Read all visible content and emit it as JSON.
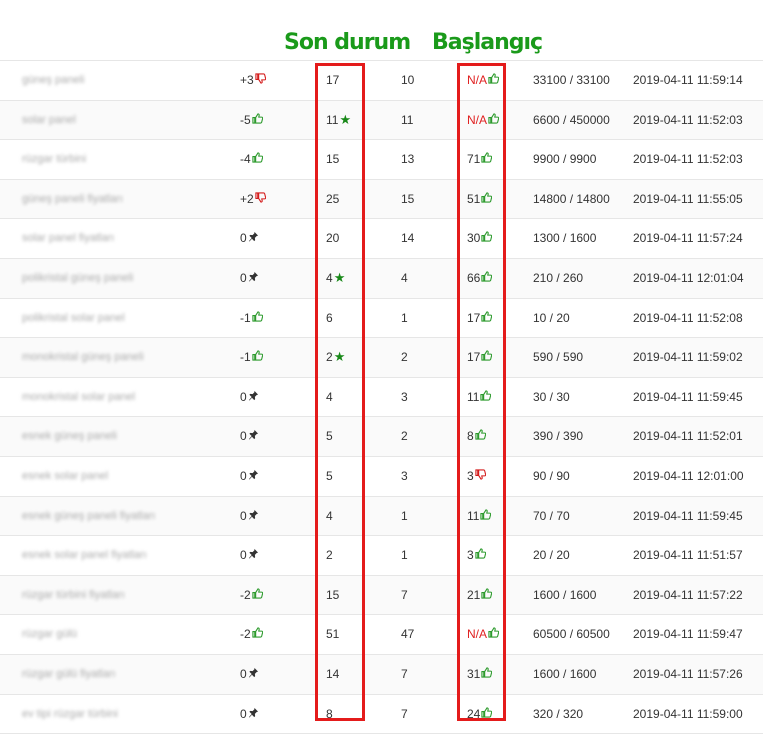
{
  "headers": {
    "son_durum": "Son durum",
    "baslangic": "Başlangıç"
  },
  "rows": [
    {
      "keyword": "güneş paneli",
      "change": "+3",
      "change_icon": "thumb-down",
      "current": "17",
      "current_icon": "",
      "previous": "10",
      "start": "N/A",
      "start_icon": "thumb-up",
      "volume": "33100 / 33100",
      "date": "2019-04-11 11:59:14"
    },
    {
      "keyword": "solar panel",
      "change": "-5",
      "change_icon": "thumb-up",
      "current": "11",
      "current_icon": "star",
      "previous": "11",
      "start": "N/A",
      "start_icon": "thumb-up",
      "volume": "6600 / 450000",
      "date": "2019-04-11 11:52:03"
    },
    {
      "keyword": "rüzgar türbini",
      "change": "-4",
      "change_icon": "thumb-up",
      "current": "15",
      "current_icon": "",
      "previous": "13",
      "start": "71",
      "start_icon": "thumb-up",
      "volume": "9900 / 9900",
      "date": "2019-04-11 11:52:03"
    },
    {
      "keyword": "güneş paneli fiyatları",
      "change": "+2",
      "change_icon": "thumb-down",
      "current": "25",
      "current_icon": "",
      "previous": "15",
      "start": "51",
      "start_icon": "thumb-up",
      "volume": "14800 / 14800",
      "date": "2019-04-11 11:55:05"
    },
    {
      "keyword": "solar panel fiyatları",
      "change": "0",
      "change_icon": "pin",
      "current": "20",
      "current_icon": "",
      "previous": "14",
      "start": "30",
      "start_icon": "thumb-up",
      "volume": "1300 / 1600",
      "date": "2019-04-11 11:57:24"
    },
    {
      "keyword": "polikristal güneş paneli",
      "change": "0",
      "change_icon": "pin",
      "current": "4",
      "current_icon": "star",
      "previous": "4",
      "start": "66",
      "start_icon": "thumb-up",
      "volume": "210 / 260",
      "date": "2019-04-11 12:01:04"
    },
    {
      "keyword": "polikristal solar panel",
      "change": "-1",
      "change_icon": "thumb-up",
      "current": "6",
      "current_icon": "",
      "previous": "1",
      "start": "17",
      "start_icon": "thumb-up",
      "volume": "10 / 20",
      "date": "2019-04-11 11:52:08"
    },
    {
      "keyword": "monokristal güneş paneli",
      "change": "-1",
      "change_icon": "thumb-up",
      "current": "2",
      "current_icon": "star",
      "previous": "2",
      "start": "17",
      "start_icon": "thumb-up",
      "volume": "590 / 590",
      "date": "2019-04-11 11:59:02"
    },
    {
      "keyword": "monokristal solar panel",
      "change": "0",
      "change_icon": "pin",
      "current": "4",
      "current_icon": "",
      "previous": "3",
      "start": "11",
      "start_icon": "thumb-up",
      "volume": "30 / 30",
      "date": "2019-04-11 11:59:45"
    },
    {
      "keyword": "esnek güneş paneli",
      "change": "0",
      "change_icon": "pin",
      "current": "5",
      "current_icon": "",
      "previous": "2",
      "start": "8",
      "start_icon": "thumb-up",
      "volume": "390 / 390",
      "date": "2019-04-11 11:52:01"
    },
    {
      "keyword": "esnek solar panel",
      "change": "0",
      "change_icon": "pin",
      "current": "5",
      "current_icon": "",
      "previous": "3",
      "start": "3",
      "start_icon": "thumb-down",
      "volume": "90 / 90",
      "date": "2019-04-11 12:01:00"
    },
    {
      "keyword": "esnek güneş paneli fiyatları",
      "change": "0",
      "change_icon": "pin",
      "current": "4",
      "current_icon": "",
      "previous": "1",
      "start": "11",
      "start_icon": "thumb-up",
      "volume": "70 / 70",
      "date": "2019-04-11 11:59:45"
    },
    {
      "keyword": "esnek solar panel fiyatları",
      "change": "0",
      "change_icon": "pin",
      "current": "2",
      "current_icon": "",
      "previous": "1",
      "start": "3",
      "start_icon": "thumb-up",
      "volume": "20 / 20",
      "date": "2019-04-11 11:51:57"
    },
    {
      "keyword": "rüzgar türbini fiyatları",
      "change": "-2",
      "change_icon": "thumb-up",
      "current": "15",
      "current_icon": "",
      "previous": "7",
      "start": "21",
      "start_icon": "thumb-up",
      "volume": "1600 / 1600",
      "date": "2019-04-11 11:57:22"
    },
    {
      "keyword": "rüzgar gülü",
      "change": "-2",
      "change_icon": "thumb-up",
      "current": "51",
      "current_icon": "",
      "previous": "47",
      "start": "N/A",
      "start_icon": "thumb-up",
      "volume": "60500 / 60500",
      "date": "2019-04-11 11:59:47"
    },
    {
      "keyword": "rüzgar gülü fiyatları",
      "change": "0",
      "change_icon": "pin",
      "current": "14",
      "current_icon": "",
      "previous": "7",
      "start": "31",
      "start_icon": "thumb-up",
      "volume": "1600 / 1600",
      "date": "2019-04-11 11:57:26"
    },
    {
      "keyword": "ev tipi rüzgar türbini",
      "change": "0",
      "change_icon": "pin",
      "current": "8",
      "current_icon": "",
      "previous": "7",
      "start": "24",
      "start_icon": "thumb-up",
      "volume": "320 / 320",
      "date": "2019-04-11 11:59:00"
    }
  ]
}
